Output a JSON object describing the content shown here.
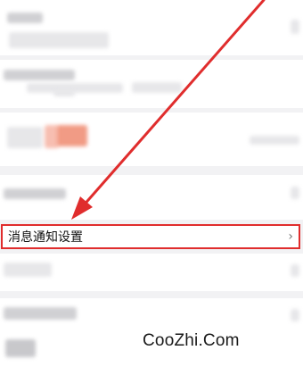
{
  "settings": {
    "highlighted_item": {
      "label": "消息通知设置",
      "chevron": "›"
    }
  },
  "annotation": {
    "arrow_color": "#e02d2d",
    "box_color": "#e02d2d"
  },
  "watermark": {
    "text": "CooZhi.Com"
  },
  "colors": {
    "background": "#f2f2f4",
    "row_background": "#ffffff",
    "highlight": "#e02d2d"
  }
}
